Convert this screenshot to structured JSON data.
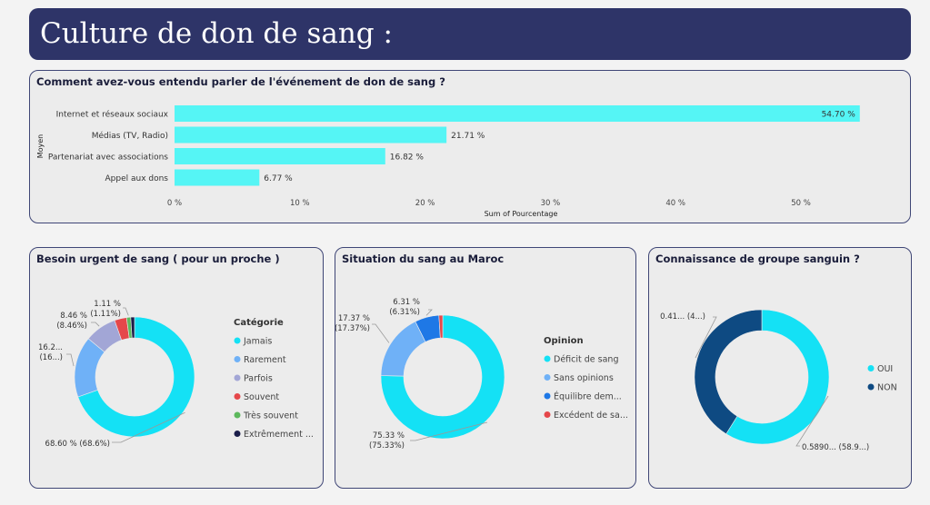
{
  "page_title": "Culture de don de sang :",
  "colors": {
    "cyan": "#14e1f5",
    "lightblue": "#6fb1f7",
    "lavender": "#a2a6d6",
    "red": "#e5474a",
    "green": "#5cb85c",
    "navy": "#1a1d4a",
    "blue": "#1e78e6",
    "darkblue": "#0e4a82",
    "barcyan": "#55f5f5"
  },
  "chart_data": [
    {
      "type": "bar",
      "orientation": "horizontal",
      "title": "Comment avez-vous entendu parler de l'événement de don de sang ?",
      "ylabel": "Moyen",
      "xlabel": "Sum of Pourcentage",
      "categories": [
        "Internet et réseaux sociaux",
        "Médias (TV, Radio)",
        "Partenariat avec associations",
        "Appel aux dons"
      ],
      "values": [
        54.7,
        21.71,
        16.82,
        6.77
      ],
      "value_labels": [
        "54.70 %",
        "21.71 %",
        "16.82 %",
        "6.77 %"
      ],
      "xticks": [
        0,
        10,
        20,
        30,
        40,
        50
      ],
      "xtick_labels": [
        "0 %",
        "10 %",
        "20 %",
        "30 %",
        "40 %",
        "50 %"
      ],
      "xlim": [
        0,
        56
      ]
    },
    {
      "type": "pie",
      "donut": true,
      "title": "Besoin urgent de sang ( pour un proche )",
      "legend_title": "Catégorie",
      "legend_position": "right",
      "categories": [
        "Jamais",
        "Rarement",
        "Parfois",
        "Souvent",
        "Très souvent",
        "Extrêmement ..."
      ],
      "values": [
        68.6,
        16.2,
        8.46,
        3.2,
        1.11,
        1.0
      ],
      "colors": [
        "#14e1f5",
        "#6fb1f7",
        "#a2a6d6",
        "#e5474a",
        "#5cb85c",
        "#1a1d4a"
      ],
      "labels": [
        {
          "l1": "68.60 % (68.6%)",
          "l2": ""
        },
        {
          "l1": "16.2...",
          "l2": "(16...)"
        },
        {
          "l1": "8.46 %",
          "l2": "(8.46%)"
        },
        {
          "l1": "",
          "l2": ""
        },
        {
          "l1": "1.11 %",
          "l2": "(1.11%)"
        },
        {
          "l1": "",
          "l2": ""
        }
      ]
    },
    {
      "type": "pie",
      "donut": true,
      "title": "Situation du sang au Maroc",
      "legend_title": "Opinion",
      "legend_position": "right",
      "categories": [
        "Déficit de sang",
        "Sans opinions",
        "Équilibre dem...",
        "Excédent de sa..."
      ],
      "values": [
        75.33,
        17.37,
        6.31,
        0.99
      ],
      "colors": [
        "#14e1f5",
        "#6fb1f7",
        "#1e78e6",
        "#e5474a"
      ],
      "labels": [
        {
          "l1": "75.33 %",
          "l2": "(75.33%)"
        },
        {
          "l1": "17.37 %",
          "l2": "(17.37%)"
        },
        {
          "l1": "6.31 %",
          "l2": "(6.31%)"
        },
        {
          "l1": "",
          "l2": ""
        }
      ]
    },
    {
      "type": "pie",
      "donut": true,
      "title": "Connaissance de groupe sanguin ?",
      "legend_position": "right",
      "categories": [
        "OUI",
        "NON"
      ],
      "values": [
        0.589,
        0.411
      ],
      "colors": [
        "#14e1f5",
        "#0e4a82"
      ],
      "labels": [
        {
          "l1": "0.5890... (58.9...)",
          "l2": ""
        },
        {
          "l1": "0.41... (4...)",
          "l2": ""
        }
      ]
    }
  ]
}
